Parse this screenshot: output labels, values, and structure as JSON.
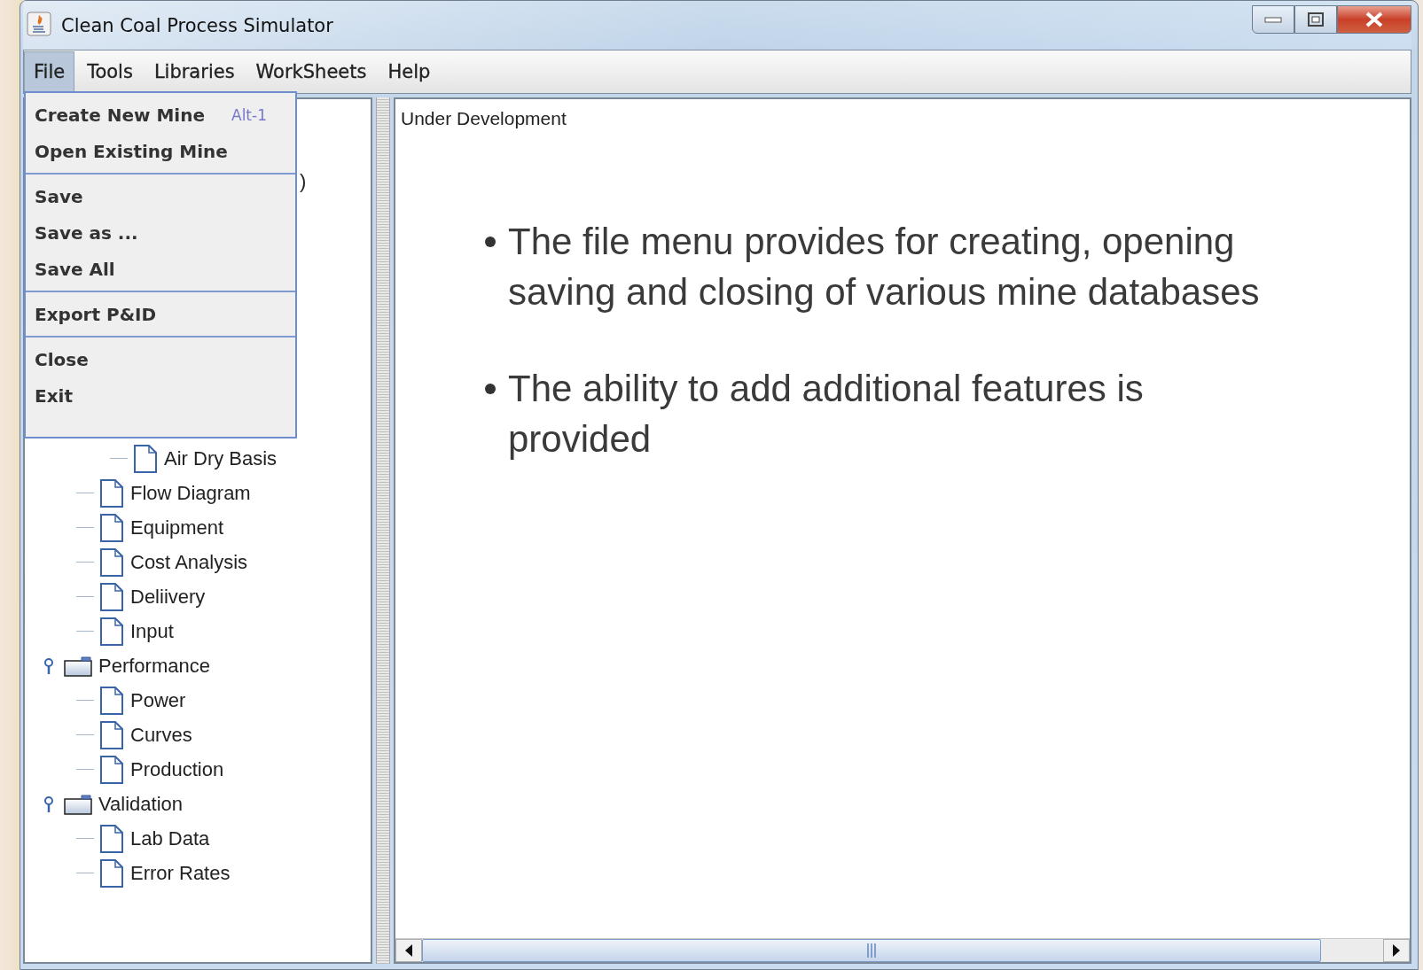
{
  "window": {
    "title": "Clean Coal Process Simulator"
  },
  "menubar": [
    {
      "label": "File",
      "selected": true
    },
    {
      "label": "Tools",
      "selected": false
    },
    {
      "label": "Libraries",
      "selected": false
    },
    {
      "label": "WorkSheets",
      "selected": false
    },
    {
      "label": "Help",
      "selected": false
    }
  ],
  "file_menu": {
    "groups": [
      [
        {
          "label": "Create New Mine",
          "shortcut": "Alt-1"
        },
        {
          "label": "Open Existing Mine"
        }
      ],
      [
        {
          "label": "Save"
        },
        {
          "label": "Save as ..."
        },
        {
          "label": "Save All"
        }
      ],
      [
        {
          "label": "Export P&ID"
        }
      ],
      [
        {
          "label": "Close"
        },
        {
          "label": "Exit"
        }
      ]
    ]
  },
  "tree": {
    "fragment": ")",
    "items": [
      {
        "children": [
          {
            "children": [
              {
                "kind": "document",
                "label": "Air Dry Basis"
              }
            ]
          },
          {
            "kind": "document",
            "label": "Flow Diagram"
          },
          {
            "kind": "document",
            "label": "Equipment"
          },
          {
            "kind": "document",
            "label": "Cost Analysis"
          },
          {
            "kind": "document",
            "label": "Deliivery"
          },
          {
            "kind": "document",
            "label": "Input"
          }
        ]
      },
      {
        "kind": "folder",
        "label": "Performance",
        "expanded": true,
        "children": [
          {
            "kind": "document",
            "label": "Power"
          },
          {
            "kind": "document",
            "label": "Curves"
          },
          {
            "kind": "document",
            "label": "Production"
          }
        ]
      },
      {
        "kind": "folder",
        "label": "Validation",
        "expanded": true,
        "children": [
          {
            "kind": "document",
            "label": "Lab Data"
          },
          {
            "kind": "document",
            "label": "Error Rates"
          }
        ]
      }
    ]
  },
  "content": {
    "heading": "Under Development",
    "bullets": [
      "The file menu provides for creating, opening saving and closing of various mine databases",
      "The ability to add additional features is provided"
    ]
  }
}
